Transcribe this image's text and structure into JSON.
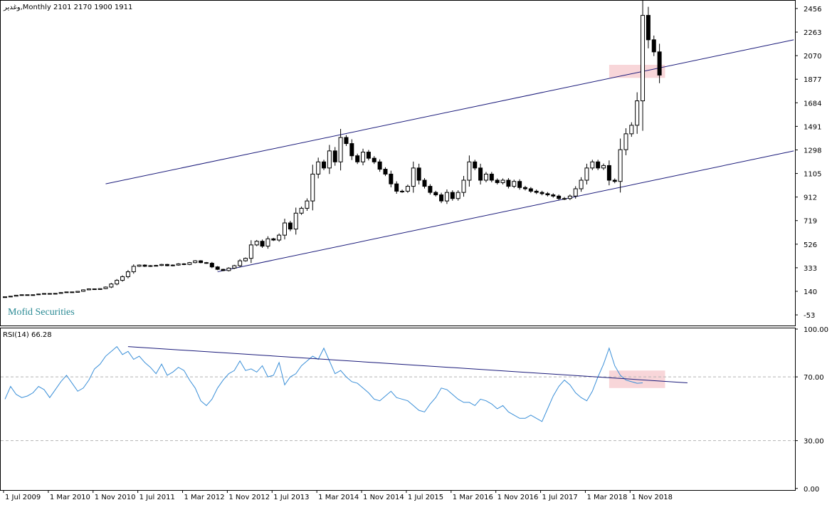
{
  "header": {
    "symbol": "وغدیر",
    "timeframe": "Monthly",
    "ohlc": "2101 2170 1900 1911"
  },
  "watermark": "Mofid Securities",
  "rsi_label": "RSI(14) 66.28",
  "colors": {
    "background": "#ffffff",
    "candle_border": "#000000",
    "bull_fill": "#ffffff",
    "bear_fill": "#000000",
    "channel_line": "#1a1a7a",
    "rsi_line": "#3a8fd8",
    "rsi_trend": "#1a1a7a",
    "highlight": "#f6c8cc",
    "grid_dash": "#b4b4b4"
  },
  "chart_data": [
    {
      "type": "candlestick",
      "timeframe": "Monthly",
      "ylim": [
        -140,
        2520
      ],
      "y_ticks": [
        2456,
        2263,
        2070,
        1877,
        1684,
        1491,
        1298,
        1105,
        912,
        719,
        526,
        333,
        140,
        -53
      ],
      "x_tick_labels": [
        "1 Jul 2009",
        "1 Mar 2010",
        "1 Nov 2010",
        "1 Jul 2011",
        "1 Mar 2012",
        "1 Nov 2012",
        "1 Jul 2013",
        "1 Mar 2014",
        "1 Nov 2014",
        "1 Jul 2015",
        "1 Mar 2016",
        "1 Nov 2016",
        "1 Jul 2017",
        "1 Mar 2018",
        "1 Nov 2018"
      ],
      "x_tick_index": [
        0,
        8,
        16,
        24,
        32,
        40,
        48,
        56,
        64,
        72,
        80,
        88,
        96,
        104,
        112
      ],
      "closes": [
        95,
        100,
        108,
        112,
        110,
        112,
        118,
        122,
        120,
        123,
        130,
        135,
        132,
        140,
        152,
        160,
        155,
        162,
        175,
        200,
        230,
        260,
        300,
        345,
        355,
        345,
        350,
        352,
        360,
        350,
        355,
        365,
        360,
        375,
        390,
        375,
        370,
        340,
        320,
        310,
        330,
        350,
        390,
        410,
        520,
        550,
        510,
        570,
        560,
        600,
        700,
        650,
        780,
        820,
        880,
        1100,
        1200,
        1150,
        1290,
        1200,
        1400,
        1350,
        1250,
        1200,
        1280,
        1230,
        1200,
        1140,
        1100,
        1020,
        960,
        960,
        1000,
        1150,
        1050,
        1000,
        950,
        930,
        880,
        950,
        900,
        950,
        1050,
        1200,
        1150,
        1050,
        1100,
        1050,
        1030,
        1050,
        1000,
        1040,
        990,
        980,
        960,
        950,
        940,
        930,
        920,
        900,
        900,
        920,
        980,
        1050,
        1150,
        1200,
        1150,
        1170,
        1050,
        1040,
        1300,
        1430,
        1500,
        1700,
        2400,
        2200,
        2101,
        1911
      ],
      "channel_upper": [
        [
          18,
          1020
        ],
        [
          141,
          2200
        ]
      ],
      "channel_lower": [
        [
          38,
          300
        ],
        [
          141,
          1290
        ]
      ],
      "highlight": {
        "x": [
          108,
          118
        ],
        "y": [
          1888,
          1995
        ]
      }
    },
    {
      "type": "line",
      "name": "RSI(14)",
      "ylim": [
        -1,
        100
      ],
      "y_ticks": [
        100.0,
        70.0,
        30.0,
        0.0
      ],
      "levels": [
        70,
        30
      ],
      "values": [
        56,
        64,
        59,
        57,
        58,
        60,
        64,
        62,
        57,
        62,
        67,
        71,
        66,
        61,
        63,
        68,
        75,
        78,
        83,
        86,
        89,
        84,
        86,
        81,
        83,
        79,
        76,
        72,
        78,
        71,
        73,
        76,
        74,
        68,
        63,
        55,
        52,
        56,
        63,
        68,
        72,
        74,
        80,
        74,
        75,
        73,
        77,
        70,
        71,
        79,
        65,
        70,
        72,
        77,
        80,
        83,
        81,
        88,
        80,
        72,
        74,
        70,
        67,
        66,
        63,
        60,
        56,
        55,
        58,
        61,
        57,
        56,
        55,
        52,
        49,
        48,
        53,
        57,
        63,
        62,
        59,
        56,
        54,
        54,
        52,
        56,
        55,
        53,
        50,
        52,
        48,
        46,
        44,
        44,
        46,
        44,
        42,
        50,
        58,
        64,
        68,
        65,
        60,
        57,
        55,
        61,
        70,
        78,
        88,
        77,
        71,
        68,
        67,
        66,
        66.28
      ],
      "trend": [
        [
          22,
          89
        ],
        [
          122,
          66.28
        ]
      ],
      "highlight": {
        "x": [
          108,
          118
        ],
        "y": [
          63,
          74
        ]
      }
    }
  ]
}
